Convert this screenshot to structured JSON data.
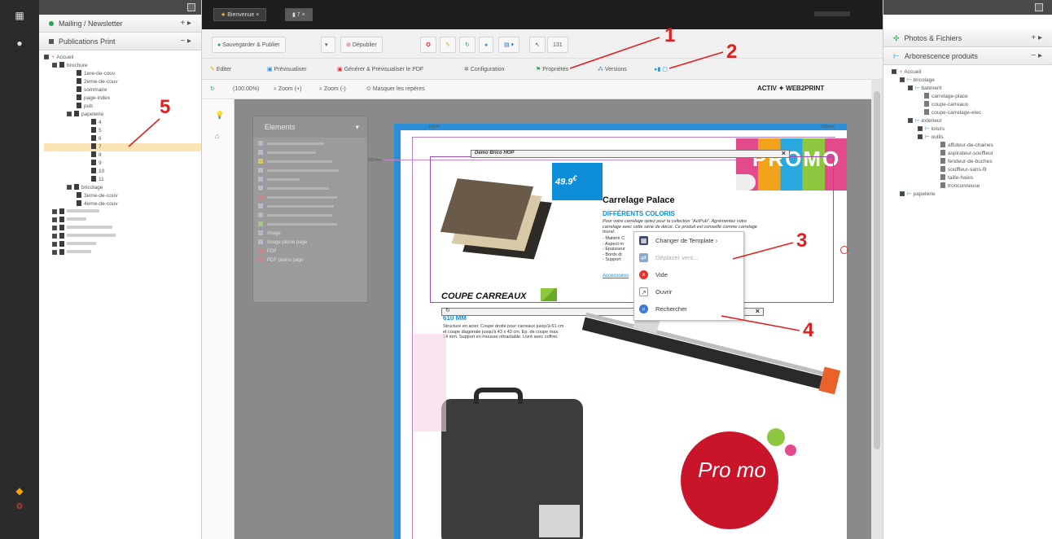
{
  "left_panel": {
    "accordions": [
      {
        "label": "Mailing / Newsletter",
        "tools": "+ ▸"
      },
      {
        "label": "Publications Print",
        "tools": "− ▸"
      }
    ],
    "tree": {
      "root": "Accueil",
      "brochure": "brochure",
      "brochure_items": [
        "1ere-de-couv",
        "2eme-de-couv",
        "sommaire",
        "page-index",
        "pub"
      ],
      "papeterie": "papeterie",
      "papeterie_items": [
        "4",
        "5",
        "6",
        "7",
        "8",
        "9",
        "10",
        "11"
      ],
      "bricolage": "bricolage",
      "bricolage_items": [
        "3eme-de-couv",
        "4eme-de-couv"
      ]
    }
  },
  "tabs": {
    "bienvenue": "Bienvenue",
    "doc": "7"
  },
  "toolbar1": {
    "save": "Sauvegarder & Publier",
    "unpublish": "Dépublier",
    "id_label": "131"
  },
  "toolbar2": {
    "edit": "Editer",
    "preview": "Prévisualiser",
    "generate_pdf": "Générer & Prévisualiser le PDF",
    "config": "Configuration",
    "properties": "Propriétés",
    "versions": "Versions"
  },
  "toolbar3": {
    "zoom_value": "(100.00%)",
    "zoom_in": "Zoom (+)",
    "zoom_out": "Zoom (-)",
    "hide_marks": "Masquer les repères",
    "brand": "ACTIV ✦ WEB2PRINT"
  },
  "palette": {
    "title": "Elements",
    "items": [
      "Image",
      "Image pleine page",
      "PDF",
      "PDF pleine page"
    ]
  },
  "document": {
    "ruler_left": "10mm",
    "ruler_right": "200mm",
    "ruler_vertical": "297mm",
    "frame_title": "Demo Brico HOP",
    "price": "49.9",
    "price_sup": "€",
    "product_title": "Carrelage Palace",
    "product_subtitle": "DIFFÉRENTS COLORIS",
    "product_text": "Pour votre carrelage optez pour la collection \"ActPub\". Agrémentez votre carrelage avec cette série de décor. Ce produit est conseillé comme carrelage mural.",
    "bullets": [
      "- Matière C",
      "- Aspect m",
      "- Epaisseur",
      "- Bords dr",
      "- Support"
    ],
    "link_text": "Accessoires",
    "section2_title": "COUPE CARREAUX",
    "section2_sub": "610 MM",
    "section2_text": "Structure en acier. Coupe droite pour carreaux jusqu'à 61 cm et coupe diagonale jusqu'à 43 x 43 cm. Ep. de coupe max. 14 mm. Support en mousse rétractable. Livré avec coffret.",
    "promo_banner": "PROMO",
    "promo_sticker": "Pro mo"
  },
  "context_menu": {
    "items": [
      "Changer de Template",
      "Déplacer vers...",
      "Vide",
      "Ouvrir",
      "Rechercher"
    ]
  },
  "annotations": [
    "1",
    "2",
    "3",
    "4",
    "5"
  ],
  "right_panel": {
    "accordions": [
      {
        "label": "Photos & Fichiers",
        "tools": "+ ▸"
      },
      {
        "label": "Arborescence produits",
        "tools": "− ▸"
      }
    ],
    "tree": {
      "root": "Accueil",
      "bricolage": "bricolage",
      "batiment": "batiment",
      "batiment_items": [
        "carrelage-place",
        "coupe-carreaux",
        "coupe-carrelage-elec"
      ],
      "exterieur": "exterieur",
      "loisirs": "loisirs",
      "outils": "outils",
      "outils_items": [
        "affuteur-de-chaines",
        "aspirateur-souffleur",
        "fendeur-de-buches",
        "souffleur-sans-fil",
        "taille-haies",
        "tronconneuse"
      ],
      "papeterie": "papeterie"
    }
  },
  "colors": {
    "accent_blue": "#2a8fd6",
    "frame_purple": "#9a4fb0",
    "annotation_red": "#e02020",
    "price_blue": "#0e8ed8",
    "selection": "#fbe5b5"
  }
}
